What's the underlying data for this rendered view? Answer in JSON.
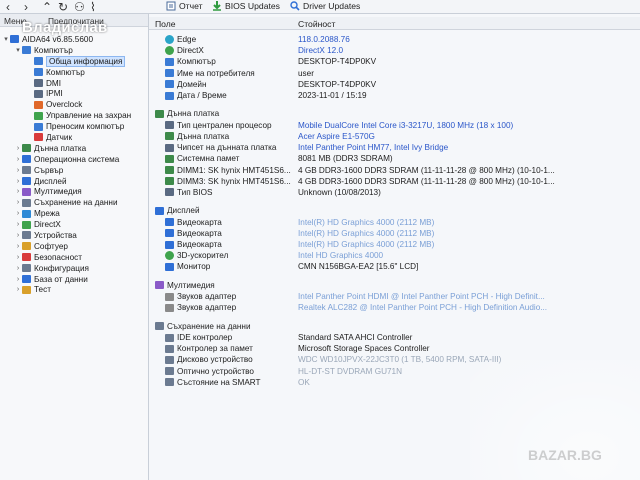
{
  "toolbar": {
    "report_label": "Отчет",
    "bios_updates_label": "BIOS Updates",
    "driver_updates_label": "Driver Updates"
  },
  "user_name": "Владислав",
  "tree": {
    "header_left": "Меню",
    "header_right": "Предпочитани",
    "items": [
      {
        "label": "AIDA64 v6.85.5600",
        "indent": 0,
        "toggle": "▾",
        "color": "#2f6fd6"
      },
      {
        "label": "Компютър",
        "indent": 1,
        "toggle": "▾",
        "color": "#3a7bd5"
      },
      {
        "label": "Обща информация",
        "indent": 2,
        "toggle": "",
        "color": "#3a7bd5",
        "selected": true
      },
      {
        "label": "Компютър",
        "indent": 2,
        "toggle": "",
        "color": "#3a7bd5"
      },
      {
        "label": "DMI",
        "indent": 2,
        "toggle": "",
        "color": "#5a6a82"
      },
      {
        "label": "IPMI",
        "indent": 2,
        "toggle": "",
        "color": "#5a6a82"
      },
      {
        "label": "Overclock",
        "indent": 2,
        "toggle": "",
        "color": "#e0682a"
      },
      {
        "label": "Управление на захран",
        "indent": 2,
        "toggle": "",
        "color": "#3fa34d"
      },
      {
        "label": "Преносим компютър",
        "indent": 2,
        "toggle": "",
        "color": "#3a7bd5"
      },
      {
        "label": "Датчик",
        "indent": 2,
        "toggle": "",
        "color": "#d93b3b"
      },
      {
        "label": "Дънна платка",
        "indent": 1,
        "toggle": "›",
        "color": "#3d8a4a"
      },
      {
        "label": "Операционна система",
        "indent": 1,
        "toggle": "›",
        "color": "#2f6fd6"
      },
      {
        "label": "Сървър",
        "indent": 1,
        "toggle": "›",
        "color": "#6b7a90"
      },
      {
        "label": "Дисплей",
        "indent": 1,
        "toggle": "›",
        "color": "#2f6fd6"
      },
      {
        "label": "Мултимедия",
        "indent": 1,
        "toggle": "›",
        "color": "#8a5ac8"
      },
      {
        "label": "Съхранение на данни",
        "indent": 1,
        "toggle": "›",
        "color": "#6b7a90"
      },
      {
        "label": "Мрежа",
        "indent": 1,
        "toggle": "›",
        "color": "#2f8ad6"
      },
      {
        "label": "DirectX",
        "indent": 1,
        "toggle": "›",
        "color": "#3fa34d"
      },
      {
        "label": "Устройства",
        "indent": 1,
        "toggle": "›",
        "color": "#6b7a90"
      },
      {
        "label": "Софтуер",
        "indent": 1,
        "toggle": "›",
        "color": "#d9a02a"
      },
      {
        "label": "Безопасност",
        "indent": 1,
        "toggle": "›",
        "color": "#d93b3b"
      },
      {
        "label": "Конфигурация",
        "indent": 1,
        "toggle": "›",
        "color": "#6b7a90"
      },
      {
        "label": "База от данни",
        "indent": 1,
        "toggle": "›",
        "color": "#2f6fd6"
      },
      {
        "label": "Тест",
        "indent": 1,
        "toggle": "›",
        "color": "#d9a02a"
      }
    ]
  },
  "main": {
    "col_field": "Поле",
    "col_value": "Стойност",
    "rows": [
      {
        "key": "Edge",
        "value": "118.0.2088.76",
        "style": "link",
        "icon": "#2aa4c8",
        "round": true,
        "indent": 1
      },
      {
        "key": "DirectX",
        "value": "DirectX 12.0",
        "style": "link",
        "icon": "#3fa34d",
        "round": true,
        "indent": 1
      },
      {
        "key": "Компютър",
        "value": "DESKTOP-T4DP0KV",
        "style": "",
        "icon": "#3a7bd5",
        "indent": 1
      },
      {
        "key": "Име на потребителя",
        "value": "user",
        "style": "",
        "icon": "#3a7bd5",
        "indent": 1
      },
      {
        "key": "Домейн",
        "value": "DESKTOP-T4DP0KV",
        "style": "",
        "icon": "#3a7bd5",
        "indent": 1
      },
      {
        "key": "Дата / Време",
        "value": "2023-11-01 / 15:19",
        "style": "",
        "icon": "#3a7bd5",
        "indent": 1
      },
      {
        "key": "",
        "value": "",
        "style": "",
        "icon": "",
        "indent": 0,
        "gap": true
      },
      {
        "key": "Дънна платка",
        "value": "",
        "style": "",
        "icon": "#3d8a4a",
        "indent": 0,
        "section": true
      },
      {
        "key": "Тип централен процесор",
        "value": "Mobile DualCore Intel Core i3-3217U, 1800 MHz (18 x 100)",
        "style": "link",
        "icon": "#5a6a82",
        "indent": 1
      },
      {
        "key": "Дънна платка",
        "value": "Acer Aspire E1-570G",
        "style": "link",
        "icon": "#3d8a4a",
        "indent": 1
      },
      {
        "key": "Чипсет на дънната платка",
        "value": "Intel Panther Point HM77, Intel Ivy Bridge",
        "style": "link",
        "icon": "#5a6a82",
        "indent": 1
      },
      {
        "key": "Системна памет",
        "value": "8081 MB  (DDR3 SDRAM)",
        "style": "",
        "icon": "#3d8a4a",
        "indent": 1
      },
      {
        "key": "DIMM1: SK hynix HMT451S6...",
        "value": "4 GB DDR3-1600 DDR3 SDRAM  (11-11-11-28 @ 800 MHz)  (10-10-1...",
        "style": "",
        "icon": "#3d8a4a",
        "indent": 1
      },
      {
        "key": "DIMM3: SK hynix HMT451S6...",
        "value": "4 GB DDR3-1600 DDR3 SDRAM  (11-11-11-28 @ 800 MHz)  (10-10-1...",
        "style": "",
        "icon": "#3d8a4a",
        "indent": 1
      },
      {
        "key": "Тип BIOS",
        "value": "Unknown (10/08/2013)",
        "style": "",
        "icon": "#5a6a82",
        "indent": 1
      },
      {
        "key": "",
        "value": "",
        "style": "",
        "icon": "",
        "indent": 0,
        "gap": true
      },
      {
        "key": "Дисплей",
        "value": "",
        "style": "",
        "icon": "#2f6fd6",
        "indent": 0,
        "section": true
      },
      {
        "key": "Видеокарта",
        "value": "Intel(R) HD Graphics 4000  (2112 MB)",
        "style": "faint",
        "icon": "#2f6fd6",
        "indent": 1
      },
      {
        "key": "Видеокарта",
        "value": "Intel(R) HD Graphics 4000  (2112 MB)",
        "style": "faint",
        "icon": "#2f6fd6",
        "indent": 1
      },
      {
        "key": "Видеокарта",
        "value": "Intel(R) HD Graphics 4000  (2112 MB)",
        "style": "faint",
        "icon": "#2f6fd6",
        "indent": 1
      },
      {
        "key": "3D-ускорител",
        "value": "Intel HD Graphics 4000",
        "style": "faint",
        "icon": "#3fa34d",
        "round": true,
        "indent": 1
      },
      {
        "key": "Монитор",
        "value": "CMN N156BGA-EA2  [15.6\" LCD]",
        "style": "",
        "icon": "#2f6fd6",
        "indent": 1
      },
      {
        "key": "",
        "value": "",
        "style": "",
        "icon": "",
        "indent": 0,
        "gap": true
      },
      {
        "key": "Мултимедия",
        "value": "",
        "style": "",
        "icon": "#8a5ac8",
        "indent": 0,
        "section": true
      },
      {
        "key": "Звуков адаптер",
        "value": "Intel Panther Point HDMI @ Intel Panther Point PCH - High Definit...",
        "style": "faint",
        "icon": "#8a8a8a",
        "indent": 1
      },
      {
        "key": "Звуков адаптер",
        "value": "Realtek ALC282 @ Intel Panther Point PCH - High Definition Audio...",
        "style": "faint",
        "icon": "#8a8a8a",
        "indent": 1
      },
      {
        "key": "",
        "value": "",
        "style": "",
        "icon": "",
        "indent": 0,
        "gap": true
      },
      {
        "key": "Съхранение на данни",
        "value": "",
        "style": "",
        "icon": "#6b7a90",
        "indent": 0,
        "section": true
      },
      {
        "key": "IDE контролер",
        "value": "Standard SATA AHCI Controller",
        "style": "",
        "icon": "#6b7a90",
        "indent": 1
      },
      {
        "key": "Контролер за памет",
        "value": "Microsoft Storage Spaces Controller",
        "style": "",
        "icon": "#6b7a90",
        "indent": 1
      },
      {
        "key": "Дисково устройство",
        "value": "WDC WD10JPVX-22JC3T0  (1 TB, 5400 RPM, SATA-III)",
        "style": "dim",
        "icon": "#6b7a90",
        "indent": 1
      },
      {
        "key": "Оптично устройство",
        "value": "HL-DT-ST DVDRAM GU71N",
        "style": "dim",
        "icon": "#6b7a90",
        "indent": 1
      },
      {
        "key": "Състояние на SMART",
        "value": "OK",
        "style": "dim",
        "icon": "#6b7a90",
        "indent": 1
      }
    ]
  },
  "watermark": "BAZAR.BG",
  "colors": {
    "link": "#2a56c9",
    "selection": "#cfe3ff",
    "panel": "#f5f7fa"
  }
}
